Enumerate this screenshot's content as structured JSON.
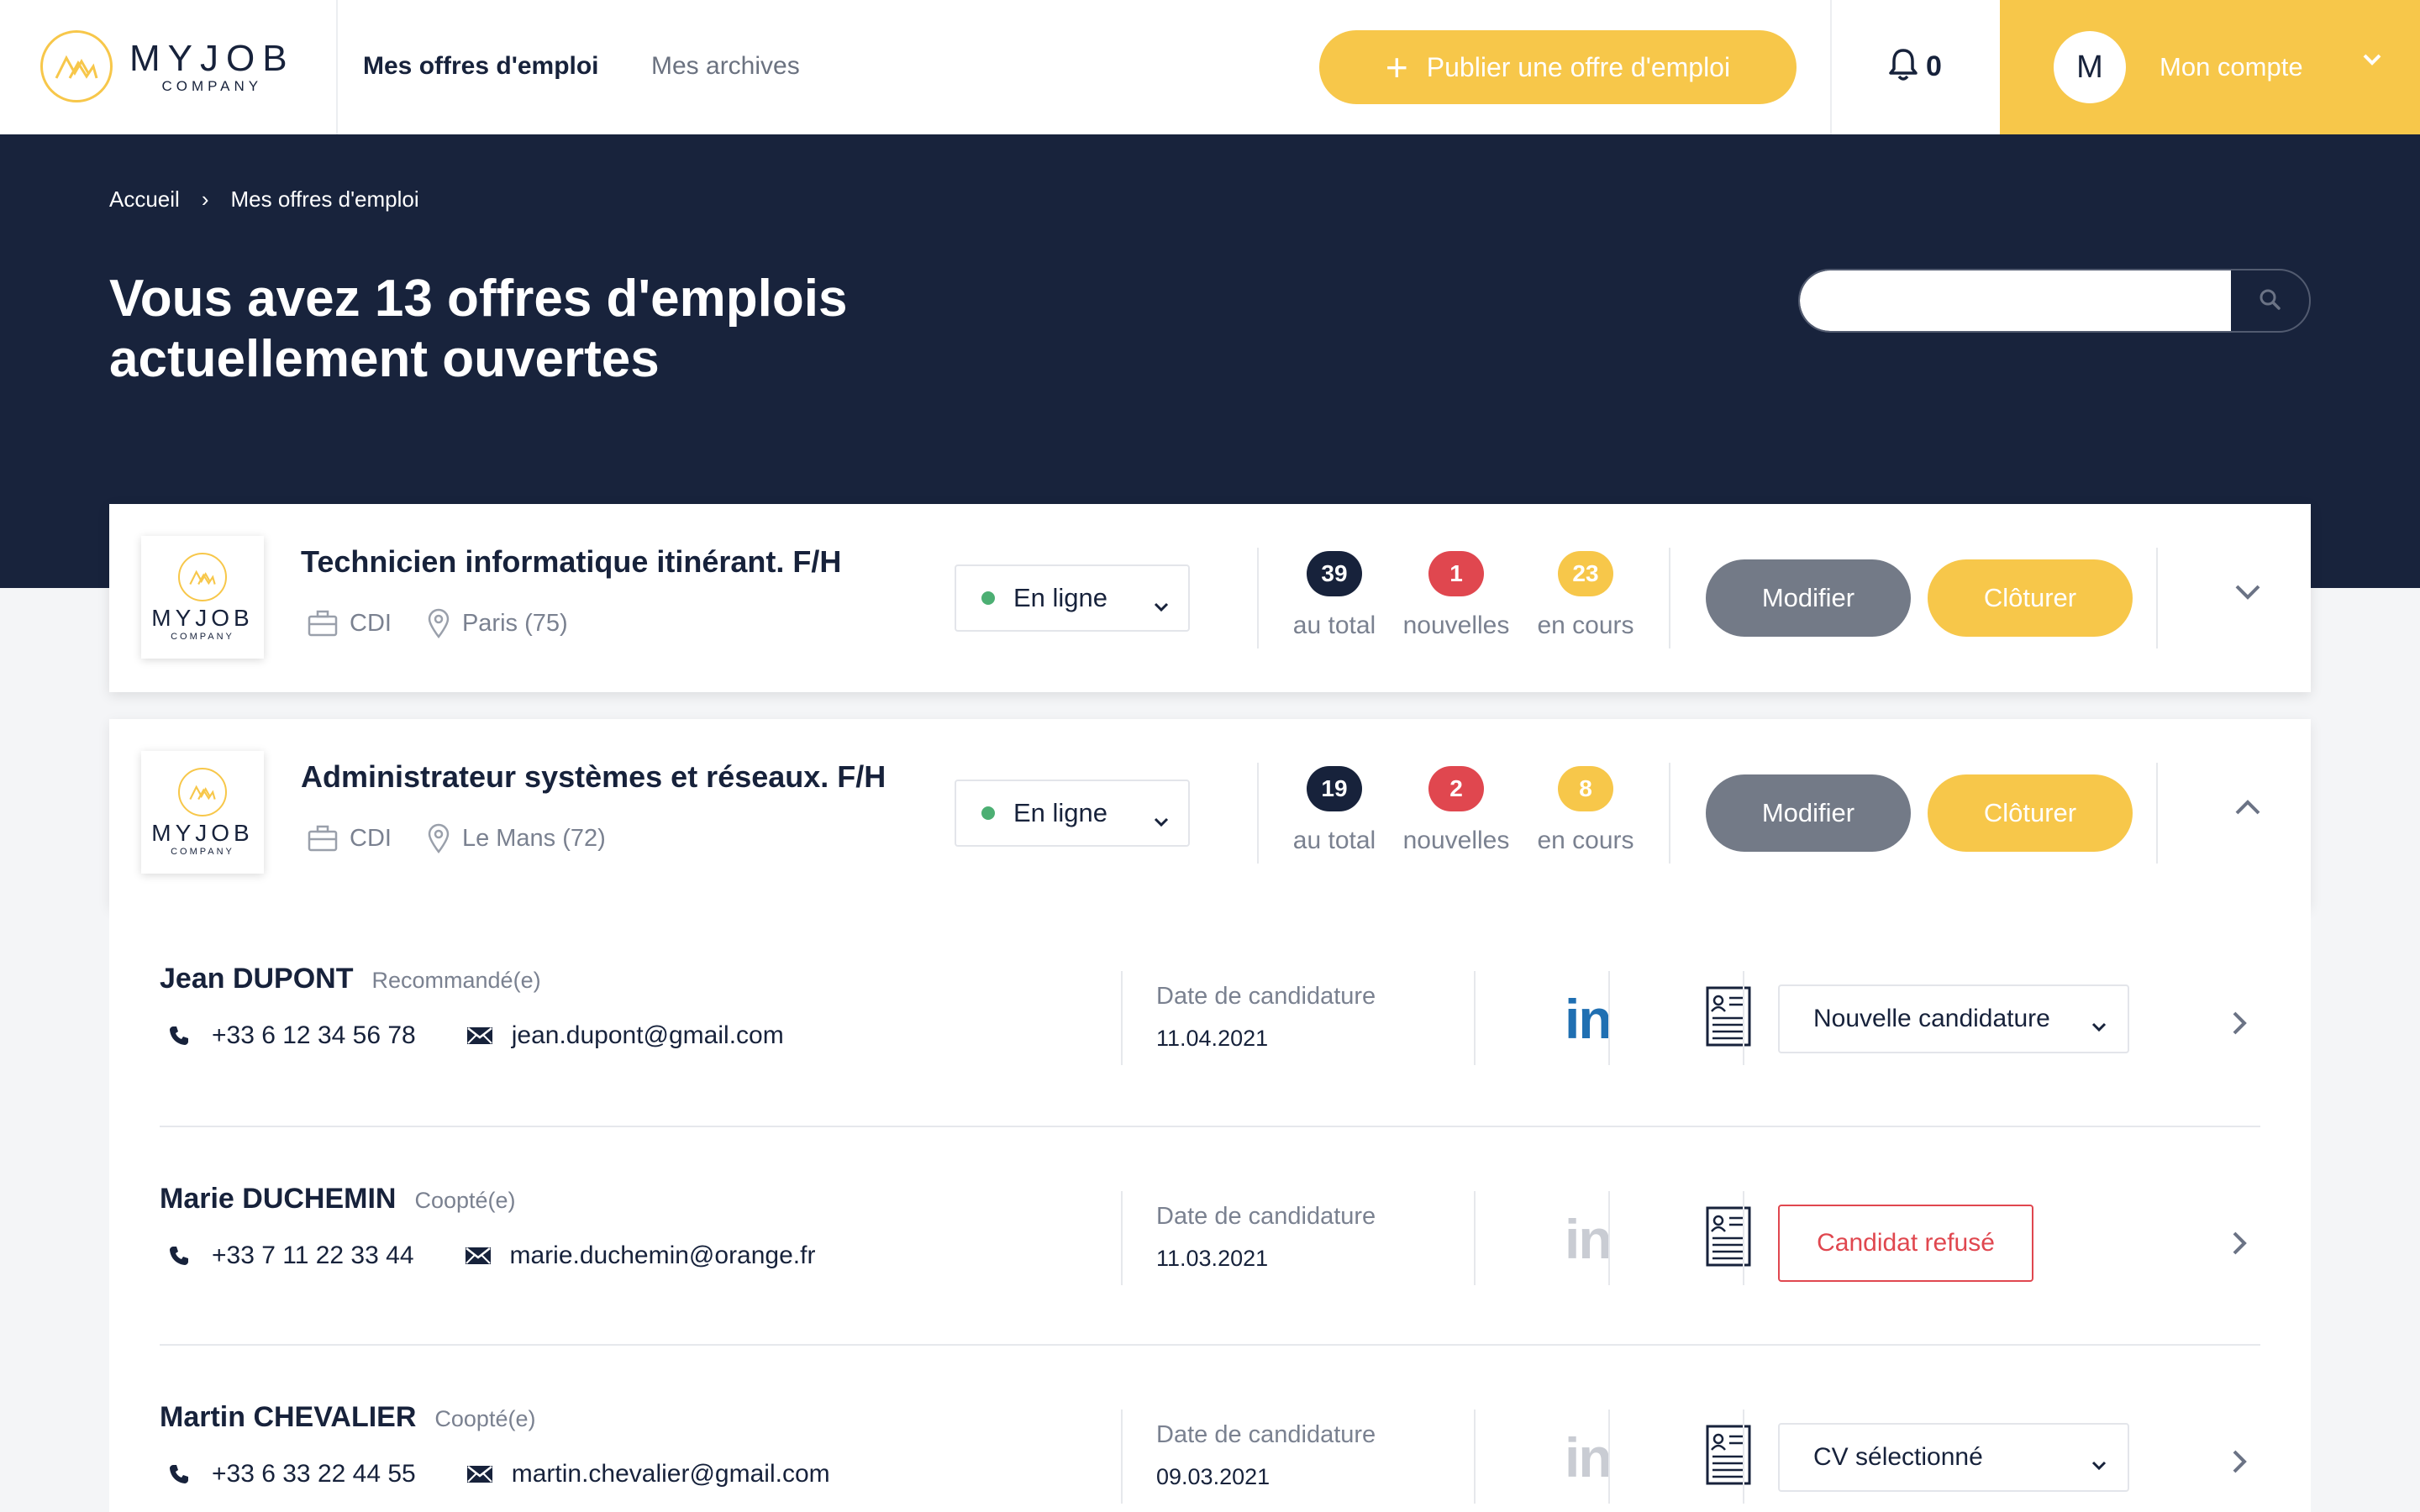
{
  "header": {
    "logo_word": "MYJOB",
    "logo_sub": "COMPANY",
    "nav": {
      "active": "Mes offres d'emploi",
      "archives": "Mes archives"
    },
    "publish_label": "Publier une offre d'emploi",
    "notifications_count": "0",
    "account": {
      "initial": "M",
      "label": "Mon compte"
    }
  },
  "hero": {
    "breadcrumb": {
      "home": "Accueil",
      "separator": "›",
      "current": "Mes offres d'emploi"
    },
    "title_line1": "Vous avez 13 offres d'emplois",
    "title_line2": "actuellement ouvertes",
    "search_placeholder": ""
  },
  "jobs": [
    {
      "title": "Technicien informatique itinérant. F/H",
      "contract": "CDI",
      "location": "Paris (75)",
      "status": "En ligne",
      "stats": [
        {
          "value": "39",
          "label": "au total"
        },
        {
          "value": "1",
          "label": "nouvelles"
        },
        {
          "value": "23",
          "label": "en cours"
        }
      ],
      "modify_label": "Modifier",
      "close_label": "Clôturer",
      "expanded": false
    },
    {
      "title": "Administrateur systèmes et réseaux. F/H",
      "contract": "CDI",
      "location": "Le Mans (72)",
      "status": "En ligne",
      "stats": [
        {
          "value": "19",
          "label": "au total"
        },
        {
          "value": "2",
          "label": "nouvelles"
        },
        {
          "value": "8",
          "label": "en cours"
        }
      ],
      "modify_label": "Modifier",
      "close_label": "Clôturer",
      "expanded": true
    }
  ],
  "candidates": [
    {
      "name": "Jean DUPONT",
      "tag": "Recommandé(e)",
      "phone": "+33 6 12 34 56 78",
      "email": "jean.dupont@gmail.com",
      "date_label": "Date de candidature",
      "date": "11.04.2021",
      "linkedin_text": "in",
      "linkedin_active": true,
      "state": "Nouvelle candidature"
    },
    {
      "name": "Marie DUCHEMIN",
      "tag": "Coopté(e)",
      "phone": "+33 7 11 22 33 44",
      "email": "marie.duchemin@orange.fr",
      "date_label": "Date de candidature",
      "date": "11.03.2021",
      "linkedin_text": "in",
      "linkedin_active": false,
      "state": "Candidat refusé"
    },
    {
      "name": "Martin CHEVALIER",
      "tag": "Coopté(e)",
      "phone": "+33 6 33 22 44 55",
      "email": "martin.chevalier@gmail.com",
      "date_label": "Date de candidature",
      "date": "09.03.2021",
      "linkedin_text": "in",
      "linkedin_active": false,
      "state": "CV sélectionné"
    }
  ],
  "colors": {
    "navy": "#18233c",
    "yellow": "#f7c74a",
    "red": "#e0474f",
    "grey_button": "#737a87",
    "online_green": "#4caf73",
    "linkedin_blue": "#1f6fb2"
  }
}
